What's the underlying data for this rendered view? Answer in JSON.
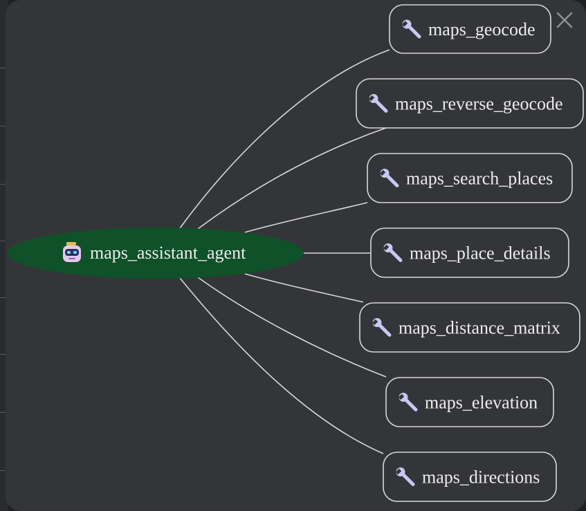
{
  "close_button": {
    "label": "×"
  },
  "graph": {
    "root": {
      "label": "maps_assistant_agent",
      "icon": "robot-icon",
      "fill": "#0f5128"
    },
    "tools": [
      {
        "label": "maps_geocode",
        "icon": "wrench-icon"
      },
      {
        "label": "maps_reverse_geocode",
        "icon": "wrench-icon"
      },
      {
        "label": "maps_search_places",
        "icon": "wrench-icon"
      },
      {
        "label": "maps_place_details",
        "icon": "wrench-icon"
      },
      {
        "label": "maps_distance_matrix",
        "icon": "wrench-icon"
      },
      {
        "label": "maps_elevation",
        "icon": "wrench-icon"
      },
      {
        "label": "maps_directions",
        "icon": "wrench-icon"
      }
    ],
    "colors": {
      "panel_bg": "#343538",
      "edge": "#d8d8d8",
      "node_border": "#d8d8d8",
      "text": "#ececec",
      "robot_body": "#e4c8f0",
      "robot_visor": "#2b2f5a",
      "robot_eye": "#6fd3ff",
      "wrench": "#c7c9f2"
    }
  }
}
